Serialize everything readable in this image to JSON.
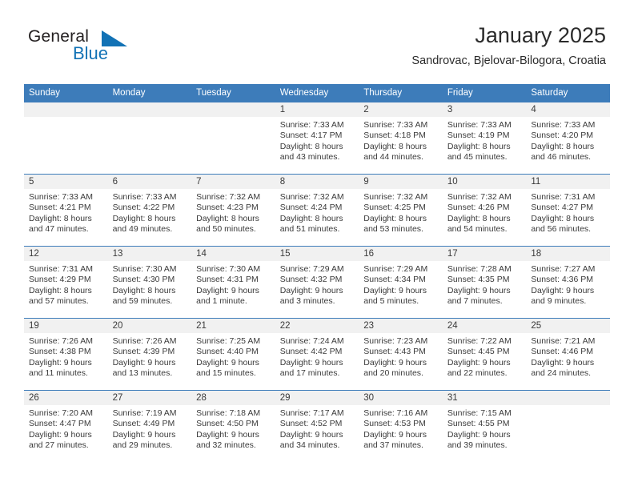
{
  "brand": {
    "name_part1": "General",
    "name_part2": "Blue",
    "triangle_icon": "triangle-icon",
    "accent_color": "#1272b5"
  },
  "header": {
    "title": "January 2025",
    "subtitle": "Sandrovac, Bjelovar-Bilogora, Croatia"
  },
  "theme": {
    "header_bg": "#3d7cba",
    "daynum_bg": "#f1f1f1",
    "text": "#3a3a3a"
  },
  "weekdays": [
    "Sunday",
    "Monday",
    "Tuesday",
    "Wednesday",
    "Thursday",
    "Friday",
    "Saturday"
  ],
  "weeks": [
    [
      {
        "day": "",
        "empty": true,
        "sunrise": "",
        "sunset": "",
        "daylight_line1": "",
        "daylight_line2": ""
      },
      {
        "day": "",
        "empty": true,
        "sunrise": "",
        "sunset": "",
        "daylight_line1": "",
        "daylight_line2": ""
      },
      {
        "day": "",
        "empty": true,
        "sunrise": "",
        "sunset": "",
        "daylight_line1": "",
        "daylight_line2": ""
      },
      {
        "day": "1",
        "empty": false,
        "sunrise": "Sunrise: 7:33 AM",
        "sunset": "Sunset: 4:17 PM",
        "daylight_line1": "Daylight: 8 hours",
        "daylight_line2": "and 43 minutes."
      },
      {
        "day": "2",
        "empty": false,
        "sunrise": "Sunrise: 7:33 AM",
        "sunset": "Sunset: 4:18 PM",
        "daylight_line1": "Daylight: 8 hours",
        "daylight_line2": "and 44 minutes."
      },
      {
        "day": "3",
        "empty": false,
        "sunrise": "Sunrise: 7:33 AM",
        "sunset": "Sunset: 4:19 PM",
        "daylight_line1": "Daylight: 8 hours",
        "daylight_line2": "and 45 minutes."
      },
      {
        "day": "4",
        "empty": false,
        "sunrise": "Sunrise: 7:33 AM",
        "sunset": "Sunset: 4:20 PM",
        "daylight_line1": "Daylight: 8 hours",
        "daylight_line2": "and 46 minutes."
      }
    ],
    [
      {
        "day": "5",
        "empty": false,
        "sunrise": "Sunrise: 7:33 AM",
        "sunset": "Sunset: 4:21 PM",
        "daylight_line1": "Daylight: 8 hours",
        "daylight_line2": "and 47 minutes."
      },
      {
        "day": "6",
        "empty": false,
        "sunrise": "Sunrise: 7:33 AM",
        "sunset": "Sunset: 4:22 PM",
        "daylight_line1": "Daylight: 8 hours",
        "daylight_line2": "and 49 minutes."
      },
      {
        "day": "7",
        "empty": false,
        "sunrise": "Sunrise: 7:32 AM",
        "sunset": "Sunset: 4:23 PM",
        "daylight_line1": "Daylight: 8 hours",
        "daylight_line2": "and 50 minutes."
      },
      {
        "day": "8",
        "empty": false,
        "sunrise": "Sunrise: 7:32 AM",
        "sunset": "Sunset: 4:24 PM",
        "daylight_line1": "Daylight: 8 hours",
        "daylight_line2": "and 51 minutes."
      },
      {
        "day": "9",
        "empty": false,
        "sunrise": "Sunrise: 7:32 AM",
        "sunset": "Sunset: 4:25 PM",
        "daylight_line1": "Daylight: 8 hours",
        "daylight_line2": "and 53 minutes."
      },
      {
        "day": "10",
        "empty": false,
        "sunrise": "Sunrise: 7:32 AM",
        "sunset": "Sunset: 4:26 PM",
        "daylight_line1": "Daylight: 8 hours",
        "daylight_line2": "and 54 minutes."
      },
      {
        "day": "11",
        "empty": false,
        "sunrise": "Sunrise: 7:31 AM",
        "sunset": "Sunset: 4:27 PM",
        "daylight_line1": "Daylight: 8 hours",
        "daylight_line2": "and 56 minutes."
      }
    ],
    [
      {
        "day": "12",
        "empty": false,
        "sunrise": "Sunrise: 7:31 AM",
        "sunset": "Sunset: 4:29 PM",
        "daylight_line1": "Daylight: 8 hours",
        "daylight_line2": "and 57 minutes."
      },
      {
        "day": "13",
        "empty": false,
        "sunrise": "Sunrise: 7:30 AM",
        "sunset": "Sunset: 4:30 PM",
        "daylight_line1": "Daylight: 8 hours",
        "daylight_line2": "and 59 minutes."
      },
      {
        "day": "14",
        "empty": false,
        "sunrise": "Sunrise: 7:30 AM",
        "sunset": "Sunset: 4:31 PM",
        "daylight_line1": "Daylight: 9 hours",
        "daylight_line2": "and 1 minute."
      },
      {
        "day": "15",
        "empty": false,
        "sunrise": "Sunrise: 7:29 AM",
        "sunset": "Sunset: 4:32 PM",
        "daylight_line1": "Daylight: 9 hours",
        "daylight_line2": "and 3 minutes."
      },
      {
        "day": "16",
        "empty": false,
        "sunrise": "Sunrise: 7:29 AM",
        "sunset": "Sunset: 4:34 PM",
        "daylight_line1": "Daylight: 9 hours",
        "daylight_line2": "and 5 minutes."
      },
      {
        "day": "17",
        "empty": false,
        "sunrise": "Sunrise: 7:28 AM",
        "sunset": "Sunset: 4:35 PM",
        "daylight_line1": "Daylight: 9 hours",
        "daylight_line2": "and 7 minutes."
      },
      {
        "day": "18",
        "empty": false,
        "sunrise": "Sunrise: 7:27 AM",
        "sunset": "Sunset: 4:36 PM",
        "daylight_line1": "Daylight: 9 hours",
        "daylight_line2": "and 9 minutes."
      }
    ],
    [
      {
        "day": "19",
        "empty": false,
        "sunrise": "Sunrise: 7:26 AM",
        "sunset": "Sunset: 4:38 PM",
        "daylight_line1": "Daylight: 9 hours",
        "daylight_line2": "and 11 minutes."
      },
      {
        "day": "20",
        "empty": false,
        "sunrise": "Sunrise: 7:26 AM",
        "sunset": "Sunset: 4:39 PM",
        "daylight_line1": "Daylight: 9 hours",
        "daylight_line2": "and 13 minutes."
      },
      {
        "day": "21",
        "empty": false,
        "sunrise": "Sunrise: 7:25 AM",
        "sunset": "Sunset: 4:40 PM",
        "daylight_line1": "Daylight: 9 hours",
        "daylight_line2": "and 15 minutes."
      },
      {
        "day": "22",
        "empty": false,
        "sunrise": "Sunrise: 7:24 AM",
        "sunset": "Sunset: 4:42 PM",
        "daylight_line1": "Daylight: 9 hours",
        "daylight_line2": "and 17 minutes."
      },
      {
        "day": "23",
        "empty": false,
        "sunrise": "Sunrise: 7:23 AM",
        "sunset": "Sunset: 4:43 PM",
        "daylight_line1": "Daylight: 9 hours",
        "daylight_line2": "and 20 minutes."
      },
      {
        "day": "24",
        "empty": false,
        "sunrise": "Sunrise: 7:22 AM",
        "sunset": "Sunset: 4:45 PM",
        "daylight_line1": "Daylight: 9 hours",
        "daylight_line2": "and 22 minutes."
      },
      {
        "day": "25",
        "empty": false,
        "sunrise": "Sunrise: 7:21 AM",
        "sunset": "Sunset: 4:46 PM",
        "daylight_line1": "Daylight: 9 hours",
        "daylight_line2": "and 24 minutes."
      }
    ],
    [
      {
        "day": "26",
        "empty": false,
        "sunrise": "Sunrise: 7:20 AM",
        "sunset": "Sunset: 4:47 PM",
        "daylight_line1": "Daylight: 9 hours",
        "daylight_line2": "and 27 minutes."
      },
      {
        "day": "27",
        "empty": false,
        "sunrise": "Sunrise: 7:19 AM",
        "sunset": "Sunset: 4:49 PM",
        "daylight_line1": "Daylight: 9 hours",
        "daylight_line2": "and 29 minutes."
      },
      {
        "day": "28",
        "empty": false,
        "sunrise": "Sunrise: 7:18 AM",
        "sunset": "Sunset: 4:50 PM",
        "daylight_line1": "Daylight: 9 hours",
        "daylight_line2": "and 32 minutes."
      },
      {
        "day": "29",
        "empty": false,
        "sunrise": "Sunrise: 7:17 AM",
        "sunset": "Sunset: 4:52 PM",
        "daylight_line1": "Daylight: 9 hours",
        "daylight_line2": "and 34 minutes."
      },
      {
        "day": "30",
        "empty": false,
        "sunrise": "Sunrise: 7:16 AM",
        "sunset": "Sunset: 4:53 PM",
        "daylight_line1": "Daylight: 9 hours",
        "daylight_line2": "and 37 minutes."
      },
      {
        "day": "31",
        "empty": false,
        "sunrise": "Sunrise: 7:15 AM",
        "sunset": "Sunset: 4:55 PM",
        "daylight_line1": "Daylight: 9 hours",
        "daylight_line2": "and 39 minutes."
      },
      {
        "day": "",
        "empty": true,
        "sunrise": "",
        "sunset": "",
        "daylight_line1": "",
        "daylight_line2": ""
      }
    ]
  ]
}
